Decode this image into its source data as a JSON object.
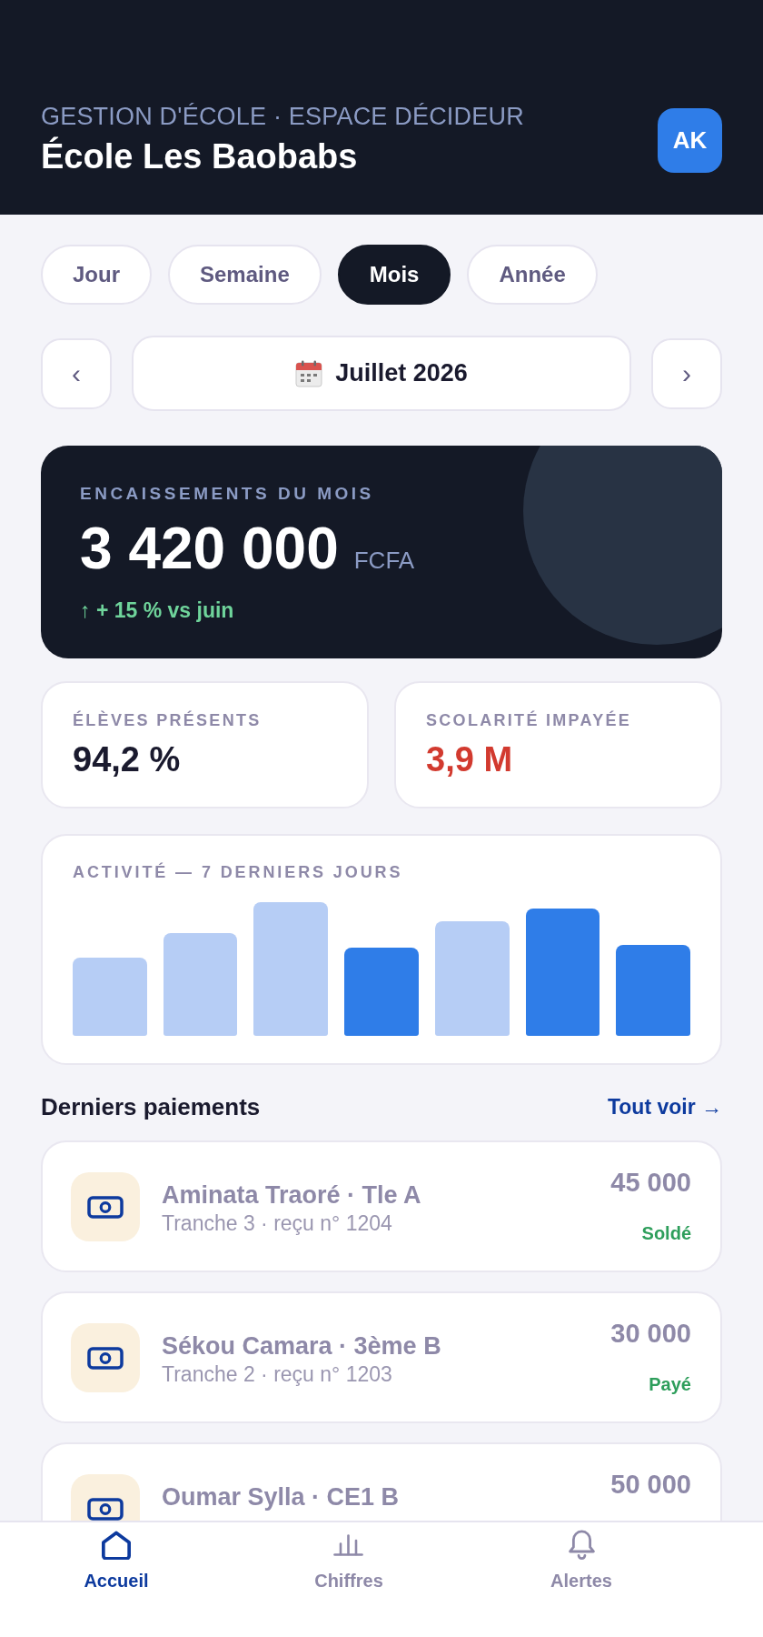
{
  "header": {
    "subtitle": "GESTION D'ÉCOLE · ESPACE DÉCIDEUR",
    "title": "École Les Baobabs",
    "avatar_initials": "AK"
  },
  "period_tabs": [
    {
      "label": "Jour",
      "selected": false
    },
    {
      "label": "Semaine",
      "selected": false
    },
    {
      "label": "Mois",
      "selected": true
    },
    {
      "label": "Année",
      "selected": false
    }
  ],
  "period_nav": {
    "previous": "‹",
    "label": "Juillet 2026",
    "next": "›"
  },
  "revenue_card": {
    "label": "ENCAISSEMENTS DU MOIS",
    "amount": "3 420 000",
    "currency": "FCFA",
    "trend": "↑ + 15 % vs juin"
  },
  "stats": [
    {
      "label": "ÉLÈVES PRÉSENTS",
      "value": "94,2 %",
      "kind": "normal"
    },
    {
      "label": "SCOLARITÉ IMPAYÉE",
      "value": "3,9 M",
      "kind": "alert"
    }
  ],
  "activity": {
    "title": "ACTIVITÉ — 7 DERNIERS JOURS"
  },
  "payments": {
    "title": "Derniers paiements",
    "link": "Tout voir →",
    "items": [
      {
        "name": "Aminata Traoré · Tle A",
        "receipt": "Tranche 3 · reçu n° 1204",
        "amount": "45 000",
        "status": "Soldé"
      },
      {
        "name": "Sékou Camara · 3ème B",
        "receipt": "Tranche 2 · reçu n° 1203",
        "amount": "30 000",
        "status": "Payé"
      },
      {
        "name": "Oumar Sylla · CE1 B",
        "amount": "50 000"
      }
    ]
  },
  "bottom_nav": [
    {
      "label": "Accueil",
      "selected": true
    },
    {
      "label": "Chiffres",
      "selected": false
    },
    {
      "label": "Alertes",
      "selected": false
    }
  ]
}
